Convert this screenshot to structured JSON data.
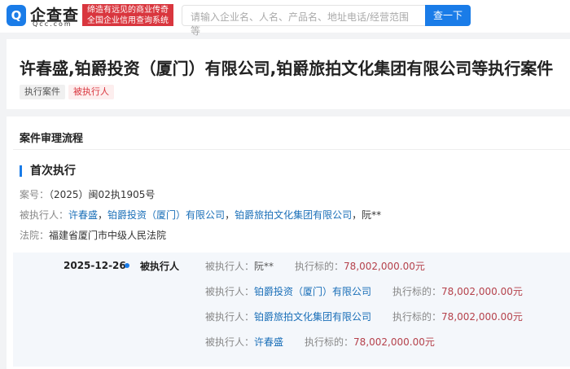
{
  "header": {
    "logo_icon": "Q",
    "logo_text": "企查查",
    "logo_sub": "Qcc.com",
    "banner_line1": "缔造有远见的商业传奇",
    "banner_line2": "全国企业信用查询系统",
    "search_placeholder": "请输入企业名、人名、产品名、地址电话/经营范围等",
    "search_button": "查一下"
  },
  "title": "许春盛,铂爵投资（厦门）有限公司,铂爵旅拍文化集团有限公司等执行案件",
  "tags": [
    "执行案件",
    "被执行人"
  ],
  "section_title": "案件审理流程",
  "sub_title": "首次执行",
  "case_no_label": "案号：",
  "case_no": "（2025）闽02执1905号",
  "executed_label": "被执行人：",
  "executed": [
    "许春盛",
    "铂爵投资（厦门）有限公司",
    "铂爵旅拍文化集团有限公司",
    "阮**"
  ],
  "separator": "，",
  "court_label": "法院：",
  "court": "福建省厦门市中级人民法院",
  "timeline": {
    "date": "2025-12-26",
    "event": "被执行人",
    "rows": [
      {
        "label": "被执行人：",
        "name": "阮**",
        "amount_label": "执行标的：",
        "amount": "78,002,000.00元"
      },
      {
        "label": "被执行人：",
        "name": "铂爵投资（厦门）有限公司",
        "amount_label": "执行标的：",
        "amount": "78,002,000.00元"
      },
      {
        "label": "被执行人：",
        "name": "铂爵旅拍文化集团有限公司",
        "amount_label": "执行标的：",
        "amount": "78,002,000.00元"
      },
      {
        "label": "被执行人：",
        "name": "许春盛",
        "amount_label": "执行标的：",
        "amount": "78,002,000.00元"
      }
    ]
  },
  "colors": {
    "accent": "#1a7ce8",
    "banner": "#d9363e",
    "amount": "#b5414b"
  }
}
